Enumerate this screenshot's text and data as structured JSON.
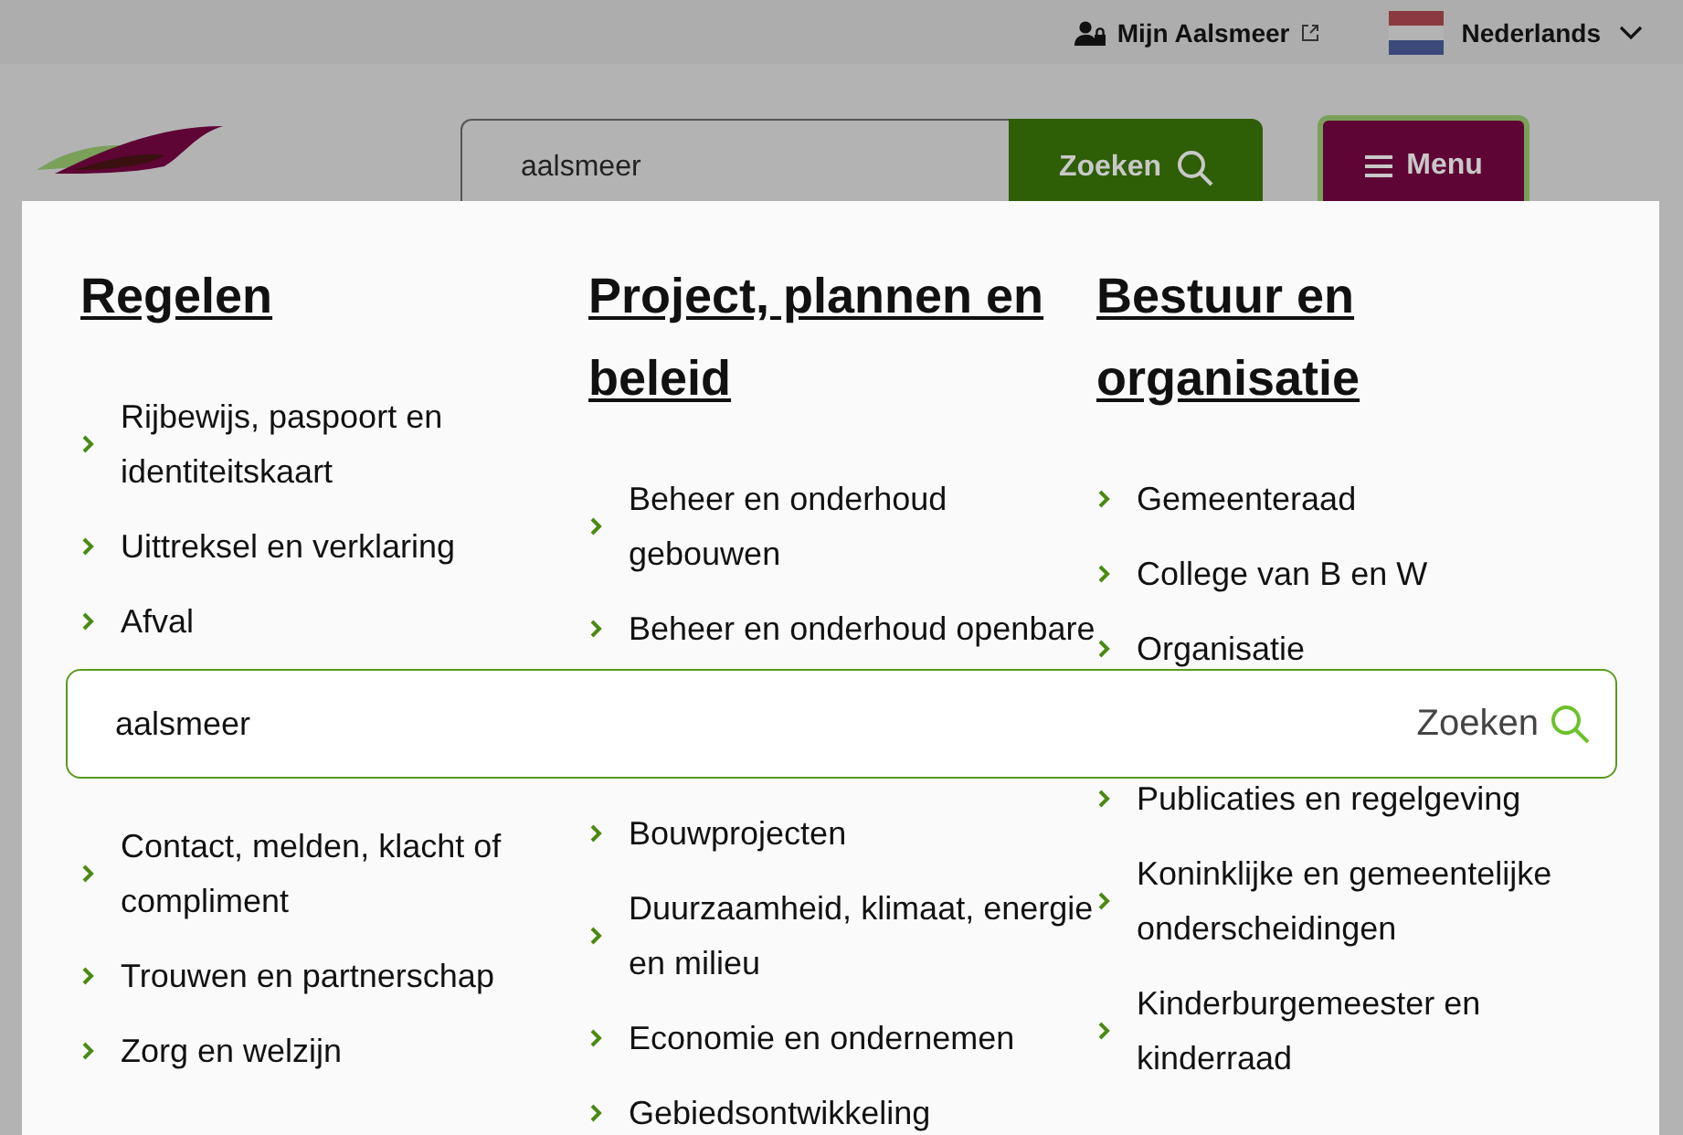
{
  "topbar": {
    "account_link": "Mijn Aalsmeer",
    "language": "Nederlands"
  },
  "header": {
    "search": {
      "value": "aalsmeer"
    },
    "search_button": "Zoeken",
    "menu_button": "Menu"
  },
  "menu": {
    "columns": [
      {
        "heading": "Regelen",
        "items": [
          "Rijbewijs, paspoort en identiteitskaart",
          "Uittreksel en verklaring",
          "Afval",
          "Contact, melden, klacht of compliment",
          "Trouwen en partnerschap",
          "Zorg en welzijn"
        ]
      },
      {
        "heading": "Project, plannen en beleid",
        "items": [
          "Beheer en onderhoud gebouwen",
          "Beheer en onderhoud openbare",
          "Bouwprojecten",
          "Duurzaamheid, klimaat, energie en milieu",
          "Economie en ondernemen",
          "Gebiedsontwikkeling"
        ]
      },
      {
        "heading": "Bestuur en organisatie",
        "items": [
          "Gemeenteraad",
          "College van B en W",
          "Organisatie",
          "Publicaties en regelgeving",
          "Koninklijke en gemeentelijke onderscheidingen",
          "Kinderburgemeester en kinderraad"
        ]
      }
    ]
  },
  "search_overlay": {
    "value": "aalsmeer",
    "button": "Zoeken"
  }
}
